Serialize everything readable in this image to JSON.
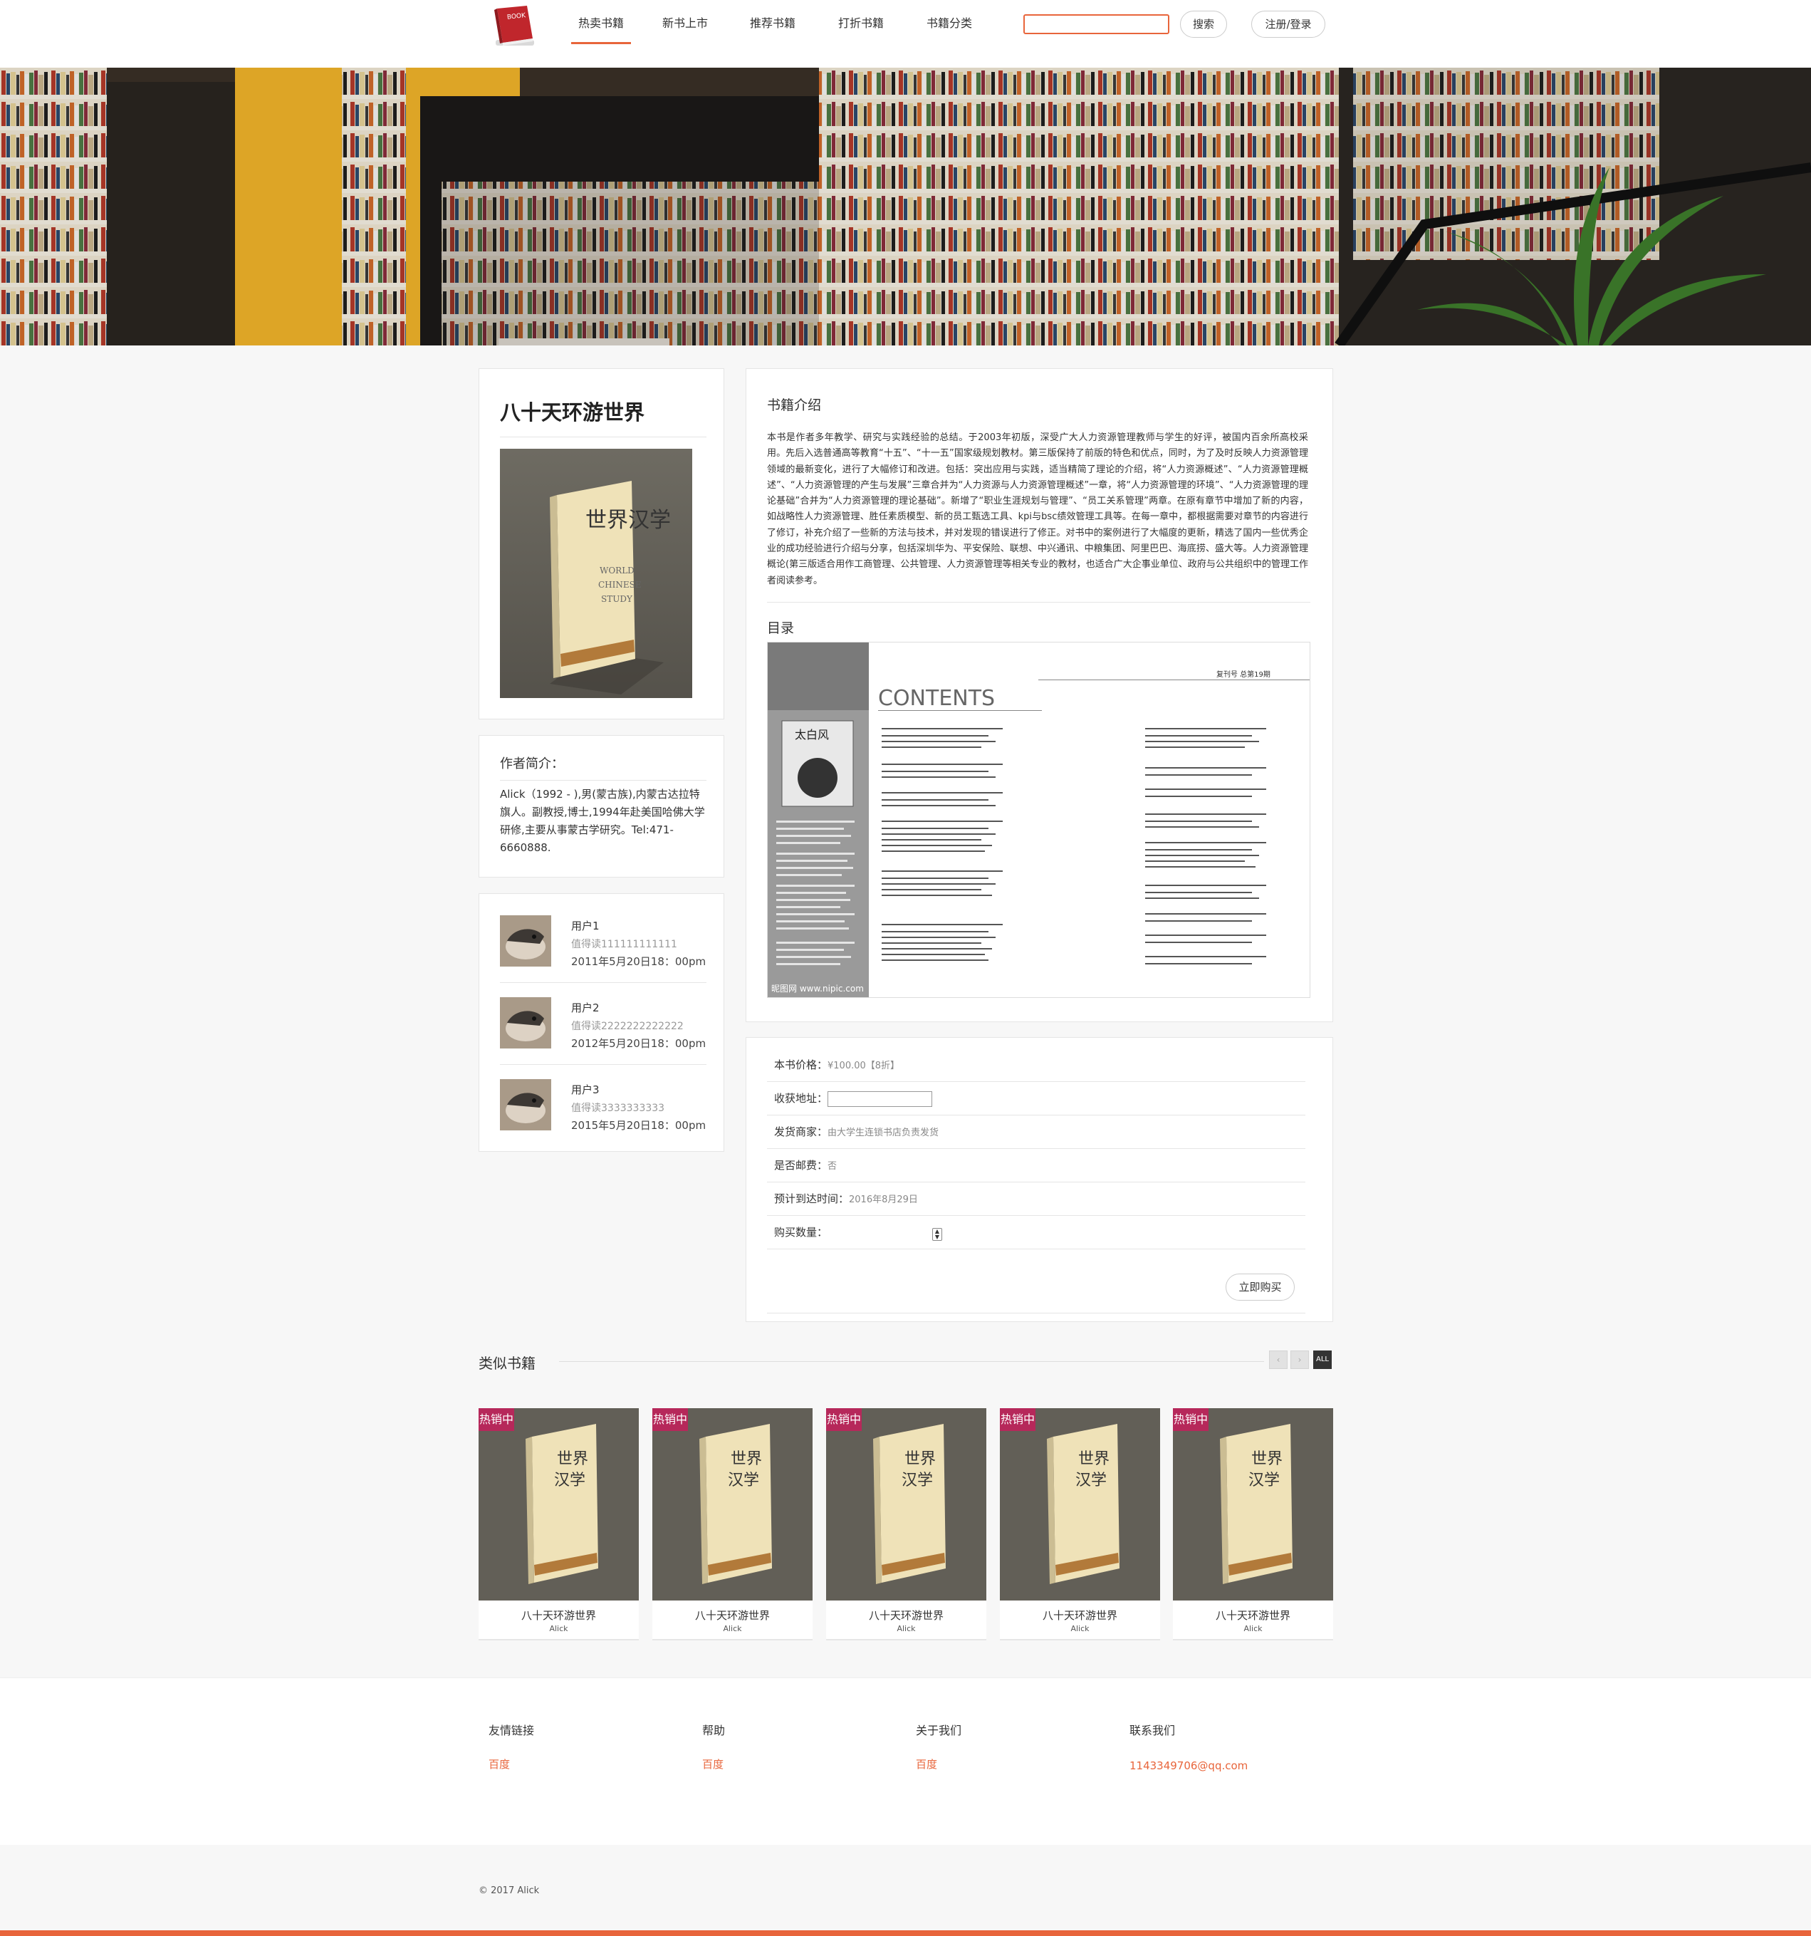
{
  "nav": {
    "items": [
      "热卖书籍",
      "新书上市",
      "推荐书籍",
      "打折书籍",
      "书籍分类"
    ],
    "search_placeholder": "",
    "search_button": "搜索",
    "login_button": "注册/登录",
    "logo_text": "BOOK"
  },
  "book": {
    "title": "八十天环游世界",
    "cover_lines": [
      "世界汉学",
      "WORLD",
      "CHINESE",
      "STUDY"
    ]
  },
  "author": {
    "heading": "作者简介：",
    "bio": "Alick（1992 - ),男(蒙古族),内蒙古达拉特旗人。副教授,博士,1994年赴美国哈佛大学研修,主要从事蒙古学研究。Tel:471-6660888."
  },
  "reviews": [
    {
      "user": "用户1",
      "text": "值得读111111111111",
      "date": "2011年5月20日18：00pm"
    },
    {
      "user": "用户2",
      "text": "值得读2222222222222",
      "date": "2012年5月20日18：00pm"
    },
    {
      "user": "用户3",
      "text": "值得读3333333333",
      "date": "2015年5月20日18：00pm"
    }
  ],
  "intro": {
    "heading": "书籍介绍",
    "text": "本书是作者多年教学、研究与实践经验的总结。于2003年初版，深受广大人力资源管理教师与学生的好评，被国内百余所高校采用。先后入选普通高等教育“十五”、“十一五”国家级规划教材。第三版保持了前版的特色和优点，同时，为了及时反映人力资源管理领域的最新变化，进行了大幅修订和改进。包括：突出应用与实践，适当精简了理论的介绍，将“人力资源概述”、“人力资源管理概述”、“人力资源管理的产生与发展”三章合并为“人力资源与人力资源管理概述”一章，将“人力资源管理的环境”、“人力资源管理的理论基础”合并为“人力资源管理的理论基础”。新增了“职业生涯规划与管理”、“员工关系管理”两章。在原有章节中增加了新的内容，如战略性人力资源管理、胜任素质模型、新的员工甄选工具、kpi与bsc绩效管理工具等。在每一章中，都根据需要对章节的内容进行了修订，补充介绍了一些新的方法与技术，并对发现的错误进行了修正。对书中的案例进行了大幅度的更新，精选了国内一些优秀企业的成功经验进行介绍与分享，包括深圳华为、平安保险、联想、中兴通讯、中粮集团、阿里巴巴、海底捞、盛大等。人力资源管理概论(第三版适合用作工商管理、公共管理、人力资源管理等相关专业的教材，也适合广大企事业单位、政府与公共组织中的管理工作者阅读参考。"
  },
  "toc": {
    "heading": "目录",
    "contents_word": "CONTENTS",
    "magazine_name": "太白风",
    "watermark": "昵图网 www.nipic.com",
    "issue": "复刊号 总第19期"
  },
  "purchase": {
    "price_label": "本书价格：",
    "price_value": "¥100.00【8折】",
    "address_label": "收获地址：",
    "seller_label": "发货商家：",
    "seller_value": "由大学生连锁书店负责发货",
    "shipping_label": "是否邮费：",
    "shipping_value": "否",
    "eta_label": "预计到达时间：",
    "eta_value": "2016年8月29日",
    "qty_label": "购买数量：",
    "buy_button": "立即购买"
  },
  "similar": {
    "heading": "类似书籍",
    "pager_all": "ALL",
    "badge": "热销中",
    "items": [
      {
        "name": "八十天环游世界",
        "author": "Alick"
      },
      {
        "name": "八十天环游世界",
        "author": "Alick"
      },
      {
        "name": "八十天环游世界",
        "author": "Alick"
      },
      {
        "name": "八十天环游世界",
        "author": "Alick"
      },
      {
        "name": "八十天环游世界",
        "author": "Alick"
      }
    ]
  },
  "footer": {
    "columns": [
      {
        "heading": "友情链接",
        "link": "百度"
      },
      {
        "heading": "帮助",
        "link": "百度"
      },
      {
        "heading": "关于我们",
        "link": "百度"
      },
      {
        "heading": "联系我们",
        "link": "1143349706@qq.com"
      }
    ],
    "copyright": "© 2017 Alick"
  },
  "colors": {
    "accent": "#e8653b",
    "badge": "#b6285a"
  }
}
